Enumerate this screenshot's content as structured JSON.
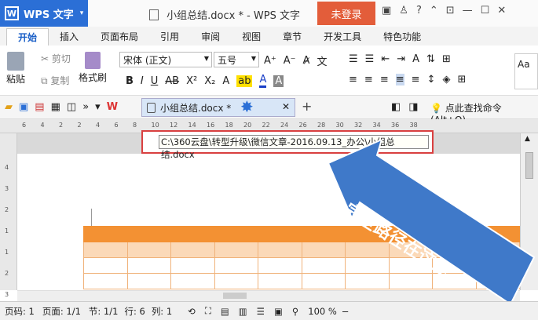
{
  "title_bar": {
    "app_button": "WPS 文字",
    "document_title": "小组总结.docx * - WPS 文字",
    "login_button": "未登录",
    "help": "?"
  },
  "menu_tabs": [
    "开始",
    "插入",
    "页面布局",
    "引用",
    "审阅",
    "视图",
    "章节",
    "开发工具",
    "特色功能"
  ],
  "ribbon": {
    "cut": "剪切",
    "paste": "粘贴",
    "copy": "复制",
    "format_painter": "格式刷",
    "font_name": "宋体 (正文)",
    "font_size": "五号",
    "bold": "B",
    "italic": "I",
    "underline": "U",
    "strikethrough": "AB",
    "superscript": "X²",
    "subscript": "X₂",
    "clear_format": "A",
    "style_preview": "Aa"
  },
  "quick_bar": {
    "document_tab": "小组总结.docx *",
    "find_command": "点此查找命令 (Alt+Q)"
  },
  "ruler_numbers": [
    "6",
    "4",
    "2",
    "2",
    "4",
    "6",
    "8",
    "10",
    "12",
    "14",
    "16",
    "18",
    "20",
    "22",
    "24",
    "26",
    "28",
    "30",
    "32",
    "34",
    "36",
    "38"
  ],
  "vruler_numbers": [
    "4",
    "3",
    "2",
    "1",
    "1",
    "2",
    "3"
  ],
  "path_tooltip": "C:\\360云盘\\转型升级\\微信文章-2016.09.13_办公\\小组总结.docx",
  "callout_text": "完全路径在这里",
  "status_bar": {
    "page_code": "页码: 1",
    "pages": "页面: 1/1",
    "section": "节: 1/1",
    "row": "行: 6",
    "column": "列: 1",
    "zoom": "100 %"
  },
  "colors": {
    "accent_blue": "#2b6fd6",
    "login_red": "#e35d3a",
    "table_orange": "#f39133",
    "callout_blue": "#3f79c9",
    "tooltip_border": "#d94040"
  }
}
